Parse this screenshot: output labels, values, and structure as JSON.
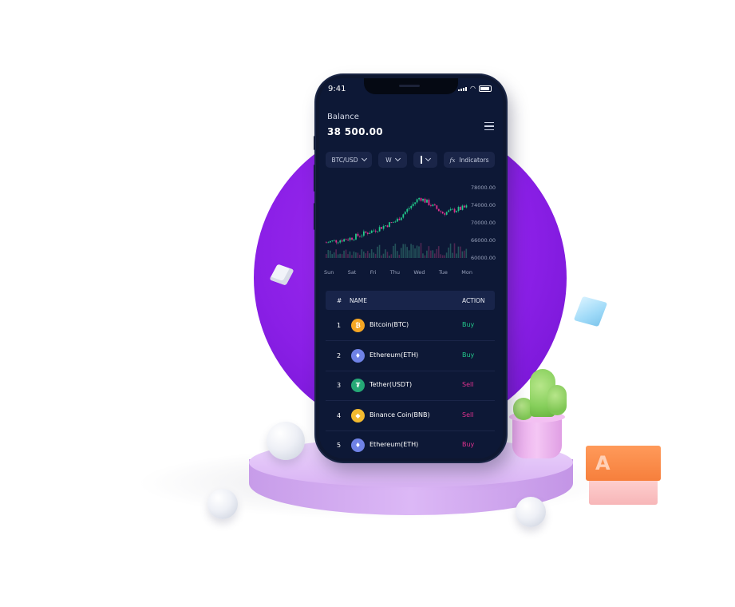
{
  "status": {
    "time": "9:41"
  },
  "balance": {
    "label": "Balance",
    "value": "38 500.00"
  },
  "controls": {
    "pair": "BTC/USD",
    "interval": "W",
    "indicators_icon": "fx",
    "indicators_label": "Indicators"
  },
  "chart_data": {
    "type": "candlestick",
    "categories": [
      "Sun",
      "Sat",
      "Fri",
      "Thu",
      "Wed",
      "Tue",
      "Mon"
    ],
    "y_ticks": [
      "78000.00",
      "74000.00",
      "70000.00",
      "66000.00",
      "60000.00"
    ],
    "ylim": [
      60000,
      78000
    ],
    "close_trend": [
      64000,
      65000,
      67000,
      69500,
      75500,
      71500,
      73000
    ],
    "colors": {
      "up": "#22c98a",
      "down": "#e0318f",
      "volume": "#3a4775"
    }
  },
  "table": {
    "headers": {
      "num": "#",
      "name": "NAME",
      "action": "ACTION"
    },
    "rows": [
      {
        "num": "1",
        "icon": "bitcoin-icon",
        "glyph": "₿",
        "color": "#f5a623",
        "name": "Bitcoin(BTC)",
        "action": "Buy",
        "action_color": "#22c98a"
      },
      {
        "num": "2",
        "icon": "ethereum-icon",
        "glyph": "♦",
        "color": "#6f82e6",
        "name": "Ethereum(ETH)",
        "action": "Buy",
        "action_color": "#22c98a"
      },
      {
        "num": "3",
        "icon": "tether-icon",
        "glyph": "₮",
        "color": "#25a876",
        "name": "Tether(USDT)",
        "action": "Sell",
        "action_color": "#e0318f"
      },
      {
        "num": "4",
        "icon": "binance-icon",
        "glyph": "◆",
        "color": "#f3ba2f",
        "name": "Binance Coin(BNB)",
        "action": "Sell",
        "action_color": "#e0318f"
      },
      {
        "num": "5",
        "icon": "ethereum-icon",
        "glyph": "♦",
        "color": "#6f82e6",
        "name": "Ethereum(ETH)",
        "action": "Buy",
        "action_color": "#e0318f"
      }
    ]
  },
  "decor": {
    "block_letter": "A"
  },
  "colors": {
    "purple": "#8a1fe6",
    "screen_bg": "#0d1836",
    "panel": "#1a2548"
  }
}
